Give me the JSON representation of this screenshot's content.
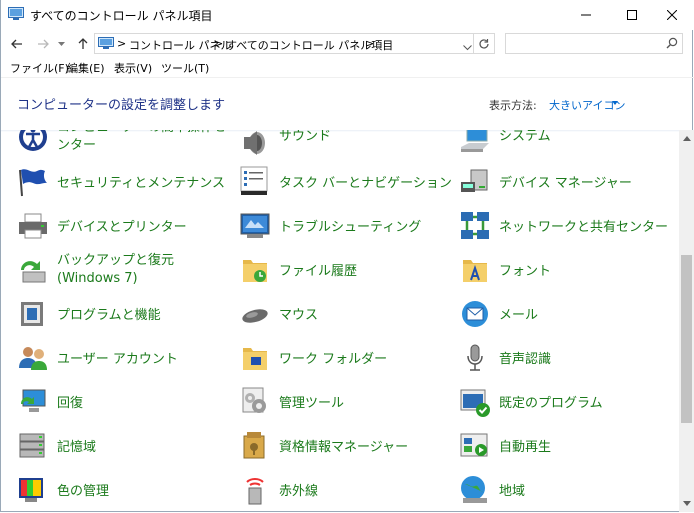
{
  "window": {
    "title": "すべてのコントロール パネル項目",
    "controls": {
      "minimize": "—",
      "maximize": "☐",
      "close": "✕"
    }
  },
  "address": {
    "breadcrumbs": [
      {
        "label": "コントロール パネル"
      },
      {
        "label": "すべてのコントロール パネル項目"
      }
    ],
    "separator": ">",
    "search_placeholder": ""
  },
  "menu": [
    "ファイル(F)",
    "編集(E)",
    "表示(V)",
    "ツール(T)"
  ],
  "header": {
    "title": "コンピューターの設定を調整します",
    "view_label": "表示方法:",
    "view_value": "大きいアイコン"
  },
  "items": [
    {
      "label": "コンピューターの簡単操作センター",
      "icon": "ease-of-access-icon"
    },
    {
      "label": "サウンド",
      "icon": "speaker-icon"
    },
    {
      "label": "システム",
      "icon": "computer-icon"
    },
    {
      "label": "セキュリティとメンテナンス",
      "icon": "flag-icon"
    },
    {
      "label": "タスク バーとナビゲーション",
      "icon": "taskbar-icon"
    },
    {
      "label": "デバイス マネージャー",
      "icon": "device-manager-icon"
    },
    {
      "label": "デバイスとプリンター",
      "icon": "printer-icon"
    },
    {
      "label": "トラブルシューティング",
      "icon": "troubleshoot-icon"
    },
    {
      "label": "ネットワークと共有センター",
      "icon": "network-icon"
    },
    {
      "label": "バックアップと復元 (Windows 7)",
      "icon": "backup-icon"
    },
    {
      "label": "ファイル履歴",
      "icon": "file-history-icon"
    },
    {
      "label": "フォント",
      "icon": "fonts-folder-icon"
    },
    {
      "label": "プログラムと機能",
      "icon": "programs-icon"
    },
    {
      "label": "マウス",
      "icon": "mouse-icon"
    },
    {
      "label": "メール",
      "icon": "mail-icon"
    },
    {
      "label": "ユーザー アカウント",
      "icon": "users-icon"
    },
    {
      "label": "ワーク フォルダー",
      "icon": "work-folders-icon"
    },
    {
      "label": "音声認識",
      "icon": "microphone-icon"
    },
    {
      "label": "回復",
      "icon": "recovery-icon"
    },
    {
      "label": "管理ツール",
      "icon": "admin-tools-icon"
    },
    {
      "label": "既定のプログラム",
      "icon": "default-programs-icon"
    },
    {
      "label": "記憶域",
      "icon": "storage-icon"
    },
    {
      "label": "資格情報マネージャー",
      "icon": "credential-manager-icon"
    },
    {
      "label": "自動再生",
      "icon": "autoplay-icon"
    },
    {
      "label": "色の管理",
      "icon": "color-management-icon"
    },
    {
      "label": "赤外線",
      "icon": "infrared-icon"
    },
    {
      "label": "地域",
      "icon": "region-globe-icon"
    }
  ],
  "colors": {
    "link": "#1b7a1b",
    "header_title": "#1e3287",
    "accent": "#0066cc"
  }
}
